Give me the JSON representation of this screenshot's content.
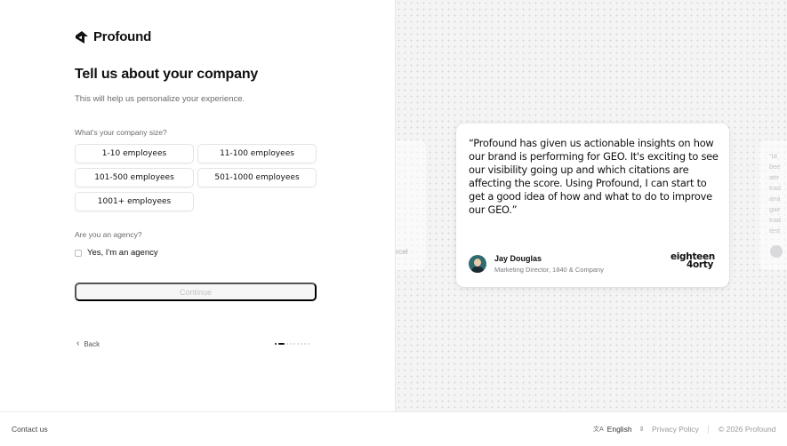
{
  "brand": {
    "name": "Profound"
  },
  "form": {
    "title": "Tell us about your company",
    "subtitle": "This will help us personalize your experience.",
    "size_question": "What's your company size?",
    "size_options": [
      "1-10 employees",
      "11-100 employees",
      "101-500 employees",
      "501-1000 employees",
      "1001+ employees"
    ],
    "agency_question": "Are you an agency?",
    "agency_checkbox_label": "Yes, I'm an agency",
    "agency_checked": false,
    "continue_label": "Continue",
    "back_label": "Back",
    "progress": {
      "current_step": 2,
      "total_steps": 9
    }
  },
  "testimonial": {
    "quote": "“Profound has given us actionable insights on how our brand is performing for GEO. It's exciting to see our visibility going up and which citations are affecting the score. Using Profound, I can start to get a good idea of how and what to do to improve our GEO.”",
    "author_name": "Jay Douglas",
    "author_role": "Marketing Director, 1840 & Company",
    "company_logo_line1": "eighteen",
    "company_logo_line2": "4orty",
    "prev_card_fragment": "rcel",
    "next_card_fragment": "“Id\nbee\nattr\ntrad\nana\ngair\ntrad\ntest"
  },
  "footer": {
    "contact": "Contact us",
    "language": "English",
    "privacy": "Privacy Policy",
    "copyright": "© 2026 Profound"
  }
}
